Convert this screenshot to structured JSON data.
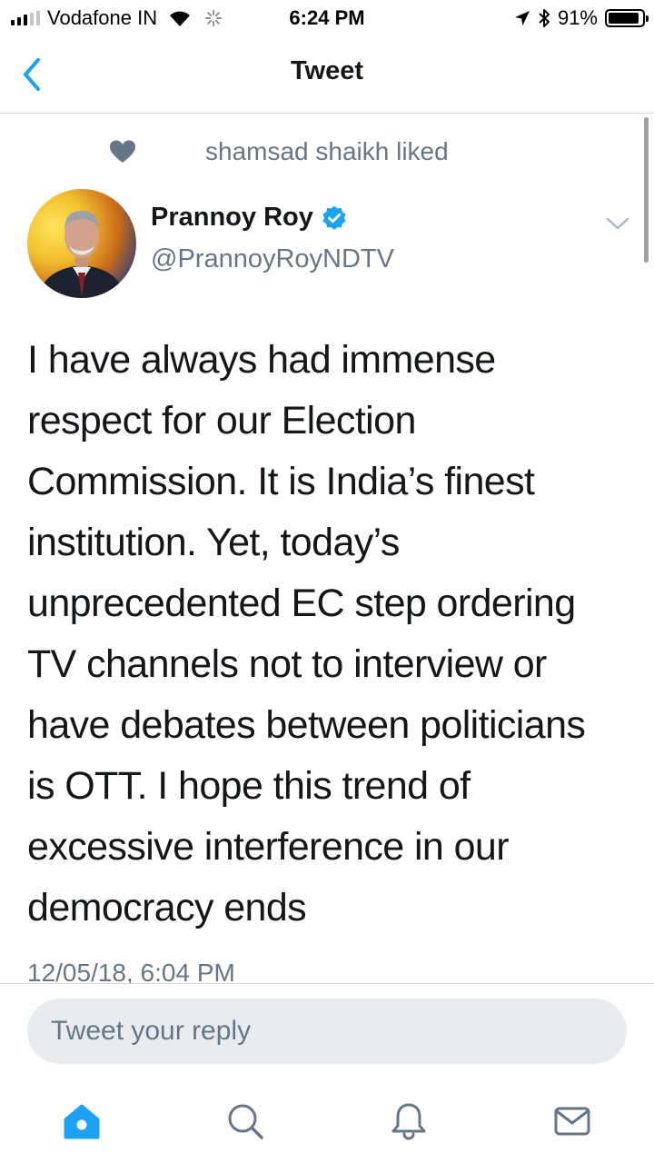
{
  "status_bar": {
    "carrier": "Vodafone IN",
    "time": "6:24 PM",
    "battery_percent": "91%",
    "battery_level": 0.91,
    "signal_bars_active": 3,
    "signal_bars_total": 5
  },
  "nav": {
    "title": "Tweet",
    "back_icon": "chevron-left-icon"
  },
  "social_context": {
    "icon": "heart-icon",
    "text": "shamsad shaikh liked"
  },
  "tweet": {
    "author_name": "Prannoy Roy",
    "verified": true,
    "author_handle": "@PrannoyRoyNDTV",
    "text": "I have always had immense\nrespect for our Election\nCommission. It is India’s finest\ninstitution. Yet, today’s\nunprecedented EC step ordering\nTV channels not to interview or\nhave debates between politicians\nis OTT. I hope this trend of\nexcessive interference in our\ndemocracy ends",
    "timestamp": "12/05/18, 6:04 PM"
  },
  "reply": {
    "placeholder": "Tweet your reply"
  },
  "tab_bar": {
    "items": [
      {
        "icon": "home-icon",
        "active": true
      },
      {
        "icon": "search-icon",
        "active": false
      },
      {
        "icon": "notifications-icon",
        "active": false
      },
      {
        "icon": "messages-icon",
        "active": false
      }
    ]
  },
  "colors": {
    "accent": "#1da1f2",
    "secondary_text": "#657786",
    "primary_text": "#14171a",
    "input_background": "#e6ecf0"
  }
}
